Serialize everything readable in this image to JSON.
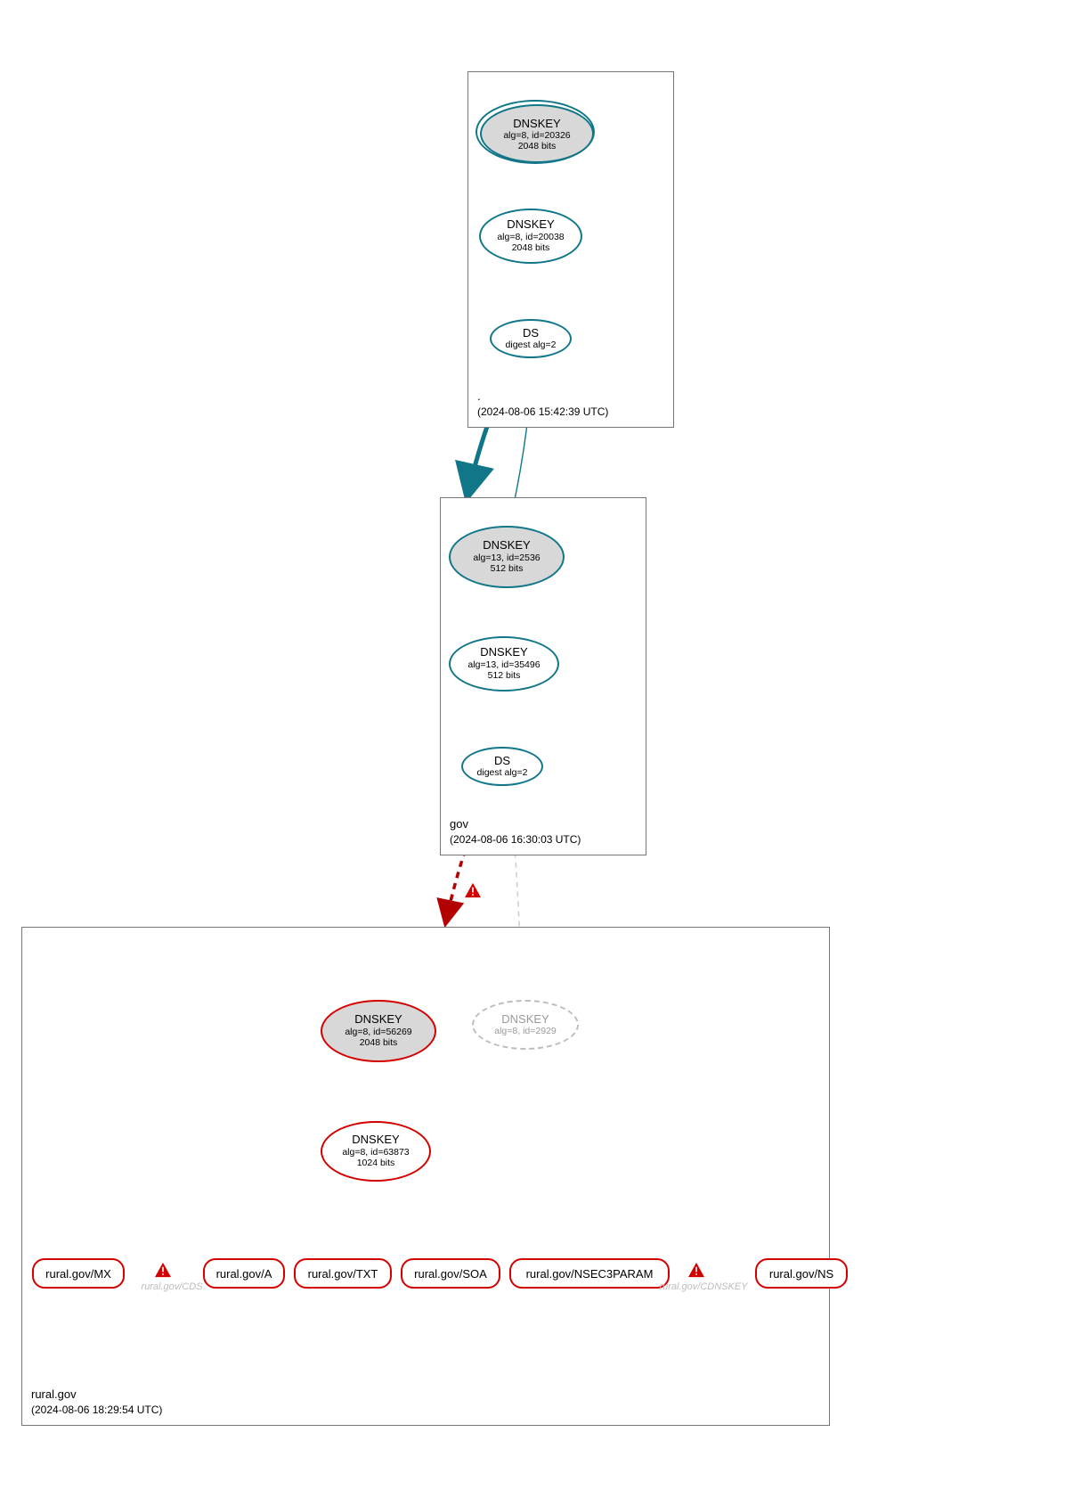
{
  "zones": {
    "root": {
      "label": ".",
      "timestamp": "(2024-08-06 15:42:39 UTC)"
    },
    "gov": {
      "label": "gov",
      "timestamp": "(2024-08-06 16:30:03 UTC)"
    },
    "rural": {
      "label": "rural.gov",
      "timestamp": "(2024-08-06 18:29:54 UTC)"
    }
  },
  "nodes": {
    "root_ksk": {
      "title": "DNSKEY",
      "line2": "alg=8, id=20326",
      "line3": "2048 bits"
    },
    "root_zsk": {
      "title": "DNSKEY",
      "line2": "alg=8, id=20038",
      "line3": "2048 bits"
    },
    "root_ds": {
      "title": "DS",
      "line2": "digest alg=2"
    },
    "gov_ksk": {
      "title": "DNSKEY",
      "line2": "alg=13, id=2536",
      "line3": "512 bits"
    },
    "gov_zsk": {
      "title": "DNSKEY",
      "line2": "alg=13, id=35496",
      "line3": "512 bits"
    },
    "gov_ds": {
      "title": "DS",
      "line2": "digest alg=2"
    },
    "rural_ksk": {
      "title": "DNSKEY",
      "line2": "alg=8, id=56269",
      "line3": "2048 bits"
    },
    "rural_gray": {
      "title": "DNSKEY",
      "line2": "alg=8, id=2929"
    },
    "rural_zsk": {
      "title": "DNSKEY",
      "line2": "alg=8, id=63873",
      "line3": "1024 bits"
    }
  },
  "hidden": {
    "cds": "rural.gov/CDS",
    "cdnskey": "rural.gov/CDNSKEY"
  },
  "rrsets": {
    "mx": "rural.gov/MX",
    "a": "rural.gov/A",
    "txt": "rural.gov/TXT",
    "soa": "rural.gov/SOA",
    "nsec3param": "rural.gov/NSEC3PARAM",
    "ns": "rural.gov/NS"
  }
}
